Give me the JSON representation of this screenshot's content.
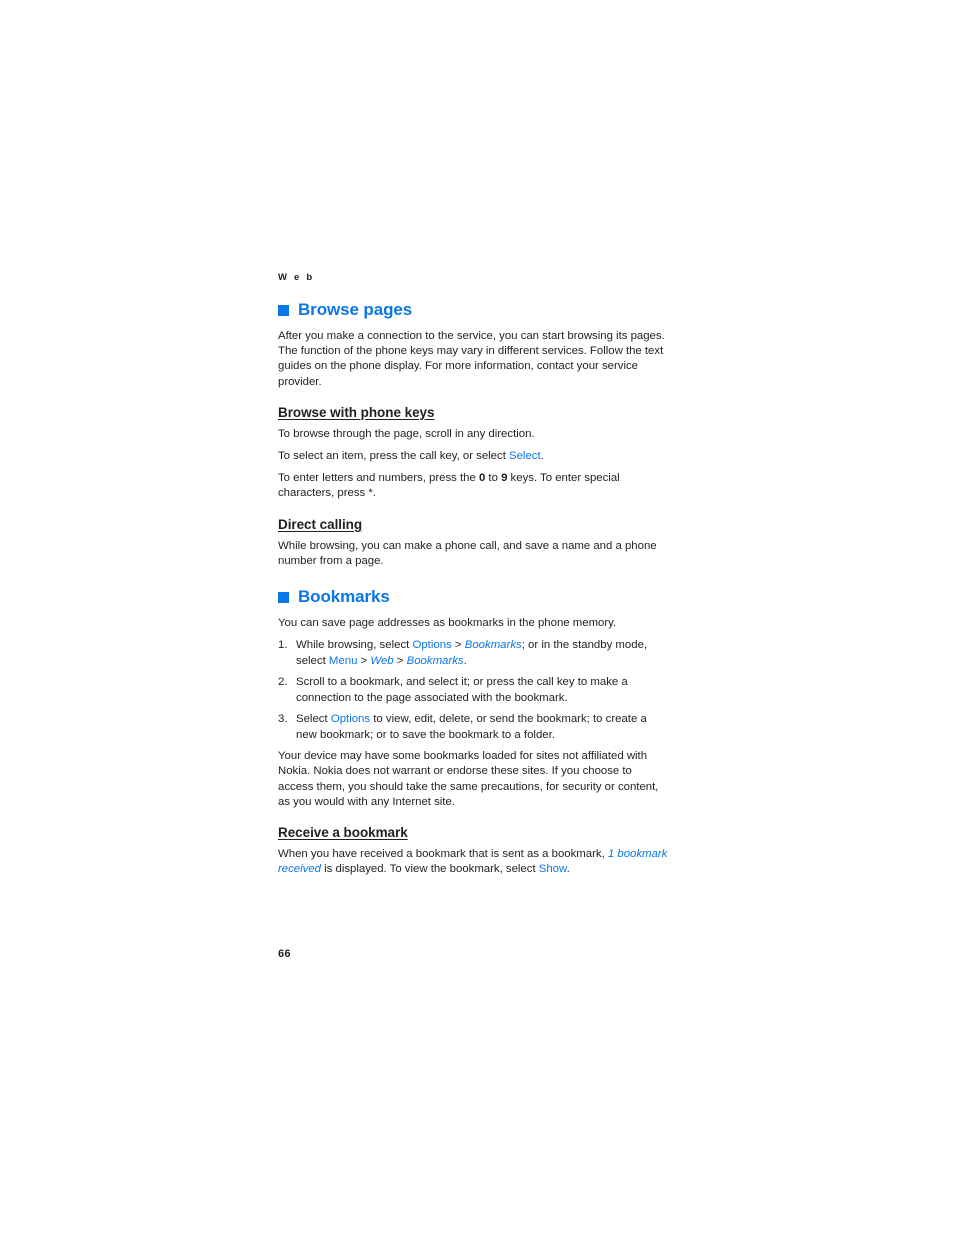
{
  "document": {
    "running_head": "W e b",
    "page_number": "66",
    "accent_color": "#0b76e8",
    "text_color": "#231f20"
  },
  "sections": [
    {
      "id": "browse-pages",
      "bullet_icon": "square-bullet-icon",
      "heading": "Browse pages",
      "intro": "After you make a connection to the service, you can start browsing its pages. The function of the phone keys may vary in different services. Follow the text guides on the phone display. For more information, contact your service provider.",
      "subsections": [
        {
          "id": "browse-with-phone-keys",
          "heading": "Browse with phone keys",
          "paragraphs": [
            {
              "id": "p-scroll",
              "parts": [
                {
                  "t": "To browse through the page, scroll in any direction.",
                  "s": "plain"
                }
              ]
            },
            {
              "id": "p-select",
              "parts": [
                {
                  "t": "To select an item, press the call key, or select ",
                  "s": "plain"
                },
                {
                  "t": "Select",
                  "s": "ui"
                },
                {
                  "t": ".",
                  "s": "plain"
                }
              ]
            },
            {
              "id": "p-keys",
              "parts": [
                {
                  "t": "To enter letters and numbers, press the ",
                  "s": "plain"
                },
                {
                  "t": "0",
                  "s": "kbd"
                },
                {
                  "t": " to ",
                  "s": "plain"
                },
                {
                  "t": "9",
                  "s": "kbd"
                },
                {
                  "t": " keys. To enter special characters, press *.",
                  "s": "plain"
                }
              ]
            }
          ]
        },
        {
          "id": "direct-calling",
          "heading": "Direct calling",
          "paragraphs": [
            {
              "id": "p-direct",
              "parts": [
                {
                  "t": "While browsing, you can make a phone call, and save a name and a phone number from a page.",
                  "s": "plain"
                }
              ]
            }
          ]
        }
      ]
    },
    {
      "id": "bookmarks",
      "bullet_icon": "square-bullet-icon",
      "heading": "Bookmarks",
      "intro": "You can save page addresses as bookmarks in the phone memory.",
      "steps": [
        {
          "num": "1.",
          "parts": [
            {
              "t": "While browsing, select ",
              "s": "plain"
            },
            {
              "t": "Options",
              "s": "ui"
            },
            {
              "t": " > ",
              "s": "sep"
            },
            {
              "t": "Bookmarks",
              "s": "uii"
            },
            {
              "t": "; or in the standby mode, select ",
              "s": "plain"
            },
            {
              "t": "Menu",
              "s": "ui"
            },
            {
              "t": " > ",
              "s": "sep"
            },
            {
              "t": "Web",
              "s": "uii"
            },
            {
              "t": " > ",
              "s": "sep"
            },
            {
              "t": "Bookmarks",
              "s": "uii"
            },
            {
              "t": ".",
              "s": "plain"
            }
          ]
        },
        {
          "num": "2.",
          "parts": [
            {
              "t": "Scroll to a bookmark, and select it; or press the call key to make a connection to the page associated with the bookmark.",
              "s": "plain"
            }
          ]
        },
        {
          "num": "3.",
          "parts": [
            {
              "t": "Select ",
              "s": "plain"
            },
            {
              "t": "Options",
              "s": "ui"
            },
            {
              "t": " to view, edit, delete, or send the bookmark; to create a new bookmark; or to save the bookmark to a folder.",
              "s": "plain"
            }
          ]
        }
      ],
      "notice": "Your device may have some bookmarks loaded for sites not affiliated with Nokia. Nokia does not warrant or endorse these sites. If you choose to access them, you should take the same precautions, for security or content, as you would with any Internet site.",
      "subsections": [
        {
          "id": "receive-a-bookmark",
          "heading": "Receive a bookmark",
          "paragraphs": [
            {
              "id": "p-receive",
              "parts": [
                {
                  "t": "When you have received a bookmark that is sent as a bookmark, ",
                  "s": "plain"
                },
                {
                  "t": "1 bookmark received",
                  "s": "uii"
                },
                {
                  "t": " is displayed. To view the bookmark, select ",
                  "s": "plain"
                },
                {
                  "t": "Show",
                  "s": "ui"
                },
                {
                  "t": ".",
                  "s": "plain"
                }
              ]
            }
          ]
        }
      ]
    }
  ]
}
